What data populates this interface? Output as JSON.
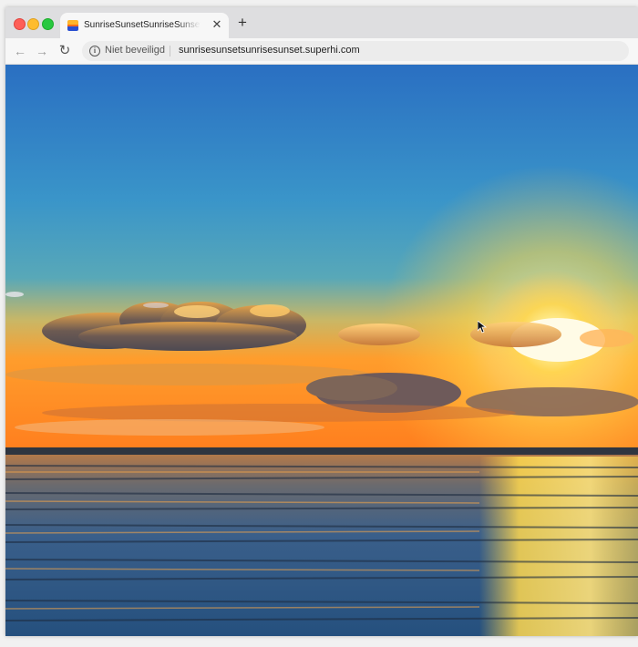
{
  "browser": {
    "tab": {
      "title": "SunriseSunsetSunriseSunset - SuperHi",
      "favicon": "sunset-favicon-icon"
    },
    "new_tab_glyph": "+",
    "close_glyph": "✕",
    "nav": {
      "back_glyph": "←",
      "forward_glyph": "→",
      "reload_glyph": "↻"
    },
    "omnibox": {
      "info_glyph": "i",
      "security_label": "Niet beveiligd",
      "url": "sunrisesunsetsunrisesunset.superhi.com"
    }
  },
  "page": {
    "image": "sunset-over-sea-photo",
    "colors": {
      "sky_top": "#2a72c4",
      "sky_mid": "#3b98c8",
      "horizon": "#ff9a2a",
      "sun": "#fff6c0",
      "sea_dark": "#23507a",
      "sea_glow": "#ffd24a"
    }
  }
}
